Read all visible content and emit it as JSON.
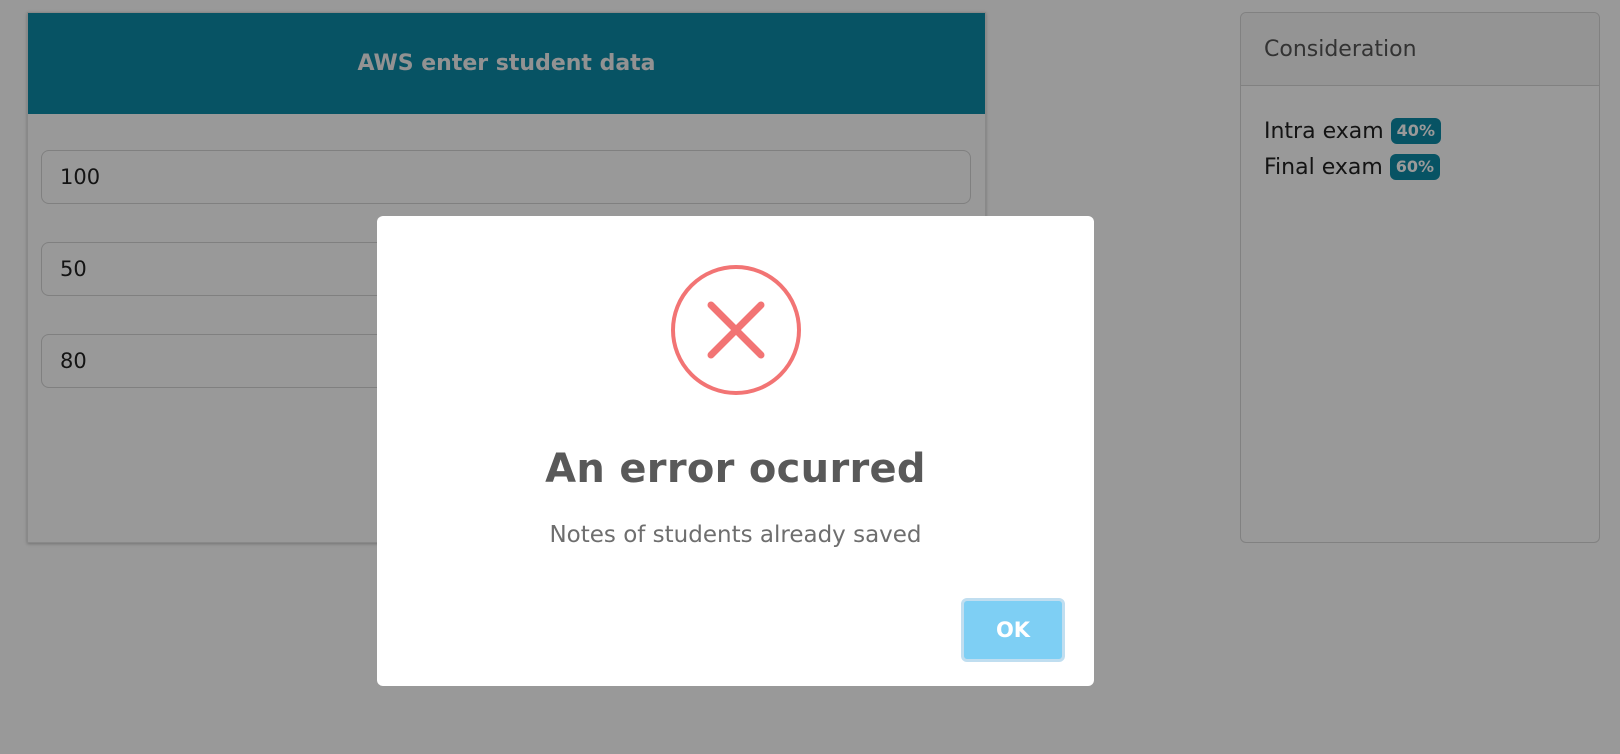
{
  "form": {
    "title": "AWS enter student data",
    "fields": [
      {
        "value": "100"
      },
      {
        "value": "50"
      },
      {
        "value": "80"
      }
    ]
  },
  "consideration": {
    "title": "Consideration",
    "items": [
      {
        "label": "Intra exam",
        "badge": "40%"
      },
      {
        "label": "Final exam",
        "badge": "60%"
      }
    ]
  },
  "dialog": {
    "icon": "error-x-icon",
    "title": "An error ocurred",
    "message": "Notes of students already saved",
    "ok_label": "OK"
  },
  "colors": {
    "header": "#0c8aa7",
    "badge": "#0c8aa7",
    "error_icon": "#f27474",
    "ok_button": "#7ecff4"
  }
}
